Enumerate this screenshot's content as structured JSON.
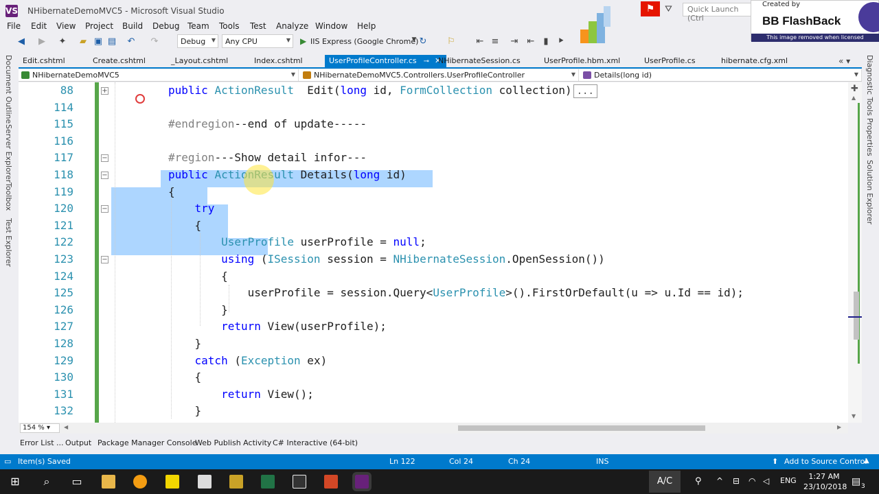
{
  "window": {
    "title": "NHibernateDemoMVC5 - Microsoft Visual Studio",
    "logo": "VS",
    "quick_launch_placeholder": "Quick Launch (Ctrl"
  },
  "overlay": {
    "created_by": "Created by",
    "name": "BB FlashBack",
    "notice": "This image removed when licensed"
  },
  "menu": [
    "File",
    "Edit",
    "View",
    "Project",
    "Build",
    "Debug",
    "Team",
    "Tools",
    "Test",
    "Analyze",
    "Window",
    "Help"
  ],
  "toolbar": {
    "config": "Debug",
    "platform": "Any CPU",
    "run_target": "IIS Express (Google Chrome)"
  },
  "side_left": [
    "Document Outline",
    "Server Explorer",
    "Toolbox",
    "Test Explorer"
  ],
  "side_right": [
    "Diagnostic Tools",
    "Properties",
    "Solution Explorer"
  ],
  "tabs": [
    {
      "label": "Edit.cshtml",
      "active": false
    },
    {
      "label": "Create.cshtml",
      "active": false
    },
    {
      "label": "_Layout.cshtml",
      "active": false
    },
    {
      "label": "Index.cshtml",
      "active": false
    },
    {
      "label": "UserProfileController.cs",
      "active": true
    },
    {
      "label": "NHibernateSession.cs",
      "active": false
    },
    {
      "label": "UserProfile.hbm.xml",
      "active": false
    },
    {
      "label": "UserProfile.cs",
      "active": false
    },
    {
      "label": "hibernate.cfg.xml",
      "active": false
    }
  ],
  "nav": {
    "project": "NHibernateDemoMVC5",
    "class": "NHibernateDemoMVC5.Controllers.UserProfileController",
    "member": "Details(long id)"
  },
  "code_lines": [
    {
      "num": "88",
      "tokens": [
        [
          "kw",
          "public "
        ],
        [
          "ty",
          "ActionResult"
        ],
        [
          "",
          "  Edit("
        ],
        [
          "kw",
          "long"
        ],
        [
          "",
          " id, "
        ],
        [
          "ty",
          "FormCollection"
        ],
        [
          "",
          " collection)"
        ]
      ],
      "collapsed": "...",
      "fold": "+"
    },
    {
      "num": "114",
      "tokens": []
    },
    {
      "num": "115",
      "tokens": [
        [
          "pr",
          "#endregion"
        ],
        [
          "",
          "--end of update-----"
        ]
      ]
    },
    {
      "num": "116",
      "tokens": []
    },
    {
      "num": "117",
      "tokens": [
        [
          "pr",
          "#region"
        ],
        [
          "",
          "---Show detail infor---"
        ]
      ],
      "fold": "−"
    },
    {
      "num": "118",
      "tokens": [
        [
          "kw",
          "public "
        ],
        [
          "ty",
          "ActionResult"
        ],
        [
          "",
          " Details("
        ],
        [
          "kw",
          "long"
        ],
        [
          "",
          " id)"
        ]
      ],
      "fold": "−"
    },
    {
      "num": "119",
      "tokens": [
        [
          "",
          "{"
        ]
      ]
    },
    {
      "num": "120",
      "tokens": [
        [
          "",
          "    "
        ],
        [
          "kw",
          "try"
        ]
      ],
      "fold": "−"
    },
    {
      "num": "121",
      "tokens": [
        [
          "",
          "    {"
        ]
      ]
    },
    {
      "num": "122",
      "tokens": [
        [
          "",
          "        "
        ],
        [
          "ty",
          "UserProfile"
        ],
        [
          "",
          " userProfile = "
        ],
        [
          "kw",
          "null"
        ],
        [
          "",
          ";"
        ]
      ]
    },
    {
      "num": "123",
      "tokens": [
        [
          "",
          "        "
        ],
        [
          "kw",
          "using"
        ],
        [
          "",
          " ("
        ],
        [
          "ty",
          "ISession"
        ],
        [
          "",
          " session = "
        ],
        [
          "ty",
          "NHibernateSession"
        ],
        [
          "",
          ".OpenSession())"
        ]
      ],
      "fold": "−"
    },
    {
      "num": "124",
      "tokens": [
        [
          "",
          "        {"
        ]
      ]
    },
    {
      "num": "125",
      "tokens": [
        [
          "",
          "            userProfile = session.Query<"
        ],
        [
          "ty",
          "UserProfile"
        ],
        [
          "",
          ">().FirstOrDefault(u => u.Id == id);"
        ]
      ]
    },
    {
      "num": "126",
      "tokens": [
        [
          "",
          "        }"
        ]
      ]
    },
    {
      "num": "127",
      "tokens": [
        [
          "",
          "        "
        ],
        [
          "kw",
          "return"
        ],
        [
          "",
          " View(userProfile);"
        ]
      ]
    },
    {
      "num": "128",
      "tokens": [
        [
          "",
          "    }"
        ]
      ]
    },
    {
      "num": "129",
      "tokens": [
        [
          "",
          "    "
        ],
        [
          "kw",
          "catch"
        ],
        [
          "",
          " ("
        ],
        [
          "ty",
          "Exception"
        ],
        [
          "",
          " ex)"
        ]
      ]
    },
    {
      "num": "130",
      "tokens": [
        [
          "",
          "    {"
        ]
      ]
    },
    {
      "num": "131",
      "tokens": [
        [
          "",
          "        "
        ],
        [
          "kw",
          "return"
        ],
        [
          "",
          " View();"
        ]
      ]
    },
    {
      "num": "132",
      "tokens": [
        [
          "",
          "    }"
        ]
      ]
    }
  ],
  "zoom": "154 %",
  "bottom_tabs": [
    "Error List ...",
    "Output",
    "Package Manager Console",
    "Web Publish Activity",
    "C# Interactive (64-bit)"
  ],
  "status": {
    "message": "Item(s) Saved",
    "ln": "Ln 122",
    "col": "Col 24",
    "ch": "Ch 24",
    "mode": "INS",
    "source_control": "Add to Source Control"
  },
  "taskbar": {
    "ac": "A/C",
    "lang": "ENG",
    "time": "1:27 AM",
    "date": "23/10/2018",
    "notif": "3"
  },
  "colors": {
    "accent": "#007acc",
    "keyword": "#0000ff",
    "type": "#2b91af",
    "selection": "#add6ff",
    "change_bar": "#57a64a"
  }
}
